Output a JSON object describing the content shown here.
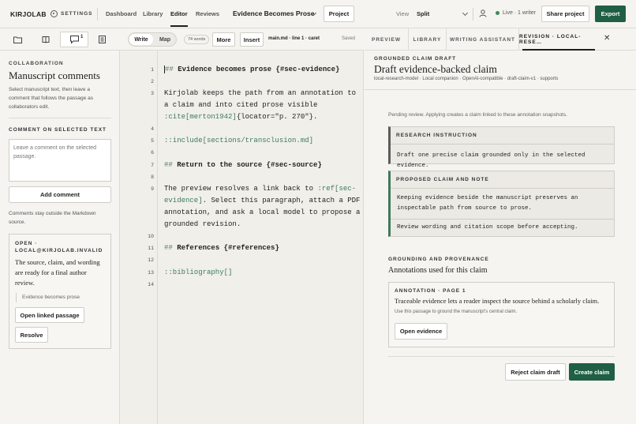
{
  "topbar": {
    "brand": "KIRJOLAB",
    "settings": "SETTINGS",
    "nav": [
      "Dashboard",
      "Library",
      "Editor",
      "Reviews"
    ],
    "doc_title": "Evidence Becomes Prose",
    "project_btn": "Project",
    "view_label": "View",
    "view_value": "Split",
    "live_status": "Live · 1 writer",
    "share_btn": "Share project",
    "export_btn": "Export"
  },
  "left": {
    "comments_badge": "1",
    "section_label": "COLLABORATION",
    "title": "Manuscript comments",
    "intro": "Select manuscript text, then leave a comment that follows the passage as collaborators edit.",
    "comment_label": "COMMENT ON SELECTED TEXT",
    "comment_placeholder": "Leave a comment on the selected passage.",
    "add_comment": "Add comment",
    "note": "Comments stay outside the Markdown source.",
    "thread": {
      "status": "OPEN · LOCAL@KIRJOLAB.INVALID",
      "body": "The source, claim, and wording are ready for a final author review.",
      "quote": "Evidence becomes prose",
      "open_btn": "Open linked passage",
      "resolve_btn": "Resolve"
    }
  },
  "editor": {
    "write": "Write",
    "map": "Map",
    "words": "74 words",
    "more": "More",
    "insert": "Insert",
    "location": "main.md · line 1 · caret",
    "saved": "Saved",
    "line_numbers": [
      "1",
      "2",
      "3",
      "4",
      "5",
      "6",
      "7",
      "8",
      "9",
      "10",
      "11",
      "12",
      "13",
      "14"
    ],
    "lines": {
      "l1": "Evidence becomes prose {#sec-evidence}",
      "l3a": "Kirjolab keeps the path from an annotation to",
      "l3b": "a claim and into cited prose visible",
      "l3c_cite": ":cite[merton1942]",
      "l3c_rest": "{locator=\"p. 270\"}.",
      "l5": "::include[sections/transclusion.md]",
      "l7": "Return to the source {#sec-source}",
      "l9a_pre": "The preview resolves a link back to ",
      "l9a_ref": ":ref[sec-",
      "l9b_ref": "evidence]",
      "l9b_rest": ". Select this paragraph, attach a PDF",
      "l9c": "annotation, and ask a local model to propose a",
      "l9d": "grounded revision.",
      "l11": "References {#references}",
      "l13": "::bibliography[]"
    }
  },
  "right": {
    "tabs": [
      "PREVIEW",
      "LIBRARY",
      "WRITING ASSISTANT",
      "REVISION · LOCAL-RESE…"
    ],
    "kicker": "GROUNDED CLAIM DRAFT",
    "title": "Draft evidence-backed claim",
    "meta": "local-research-model · Local companion · OpenAI-compatible · draft-claim-v1 · supports",
    "pending": "Pending review. Applying creates a claim linked to these annotation snapshots.",
    "instruction_label": "RESEARCH INSTRUCTION",
    "instruction": "Draft one precise claim grounded only in the selected evidence.",
    "proposed_label": "PROPOSED CLAIM AND NOTE",
    "proposed_a": "Keeping evidence beside the manuscript preserves an inspectable path from source to prose.",
    "proposed_b": "Review wording and citation scope before accepting.",
    "grounding_label": "GROUNDING AND PROVENANCE",
    "grounding_title": "Annotations used for this claim",
    "annotation_label": "ANNOTATION · PAGE 1",
    "annotation_quote": "Traceable evidence lets a reader inspect the source behind a scholarly claim.",
    "annotation_use": "Use this passage to ground the manuscript's central claim.",
    "open_evidence": "Open evidence",
    "reject": "Reject claim draft",
    "create": "Create claim"
  },
  "colors": {
    "accent": "#1f5f44",
    "live": "#3d8a5a"
  }
}
